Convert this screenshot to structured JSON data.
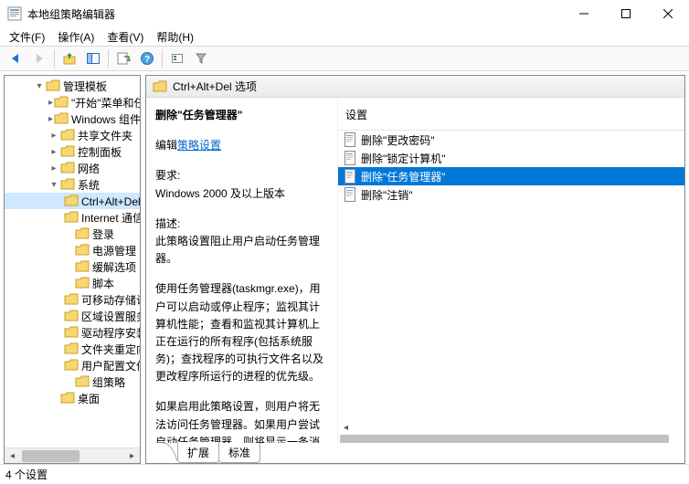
{
  "window": {
    "title": "本地组策略编辑器"
  },
  "menu": {
    "file": "文件(F)",
    "action": "操作(A)",
    "view": "查看(V)",
    "help": "帮助(H)"
  },
  "tree": [
    {
      "level": 2,
      "toggle": "▾",
      "label": "管理模板"
    },
    {
      "level": 3,
      "toggle": "▸",
      "label": "\"开始\"菜单和任务栏"
    },
    {
      "level": 3,
      "toggle": "▸",
      "label": "Windows 组件"
    },
    {
      "level": 3,
      "toggle": "▸",
      "label": "共享文件夹"
    },
    {
      "level": 3,
      "toggle": "▸",
      "label": "控制面板"
    },
    {
      "level": 3,
      "toggle": "▸",
      "label": "网络"
    },
    {
      "level": 3,
      "toggle": "▾",
      "label": "系统"
    },
    {
      "level": 4,
      "toggle": "",
      "label": "Ctrl+Alt+Del 选项",
      "selected": true
    },
    {
      "level": 4,
      "toggle": "",
      "label": "Internet 通信管理"
    },
    {
      "level": 4,
      "toggle": "",
      "label": "登录"
    },
    {
      "level": 4,
      "toggle": "",
      "label": "电源管理"
    },
    {
      "level": 4,
      "toggle": "",
      "label": "缓解选项"
    },
    {
      "level": 4,
      "toggle": "",
      "label": "脚本"
    },
    {
      "level": 4,
      "toggle": "",
      "label": "可移动存储访问"
    },
    {
      "level": 4,
      "toggle": "",
      "label": "区域设置服务"
    },
    {
      "level": 4,
      "toggle": "",
      "label": "驱动程序安装"
    },
    {
      "level": 4,
      "toggle": "",
      "label": "文件夹重定向"
    },
    {
      "level": 4,
      "toggle": "",
      "label": "用户配置文件"
    },
    {
      "level": 4,
      "toggle": "",
      "label": "组策略"
    },
    {
      "level": 3,
      "toggle": "",
      "label": "桌面"
    }
  ],
  "content": {
    "header": "Ctrl+Alt+Del 选项",
    "policy_name": "删除\"任务管理器\"",
    "edit_prefix": "编辑",
    "edit_link": "策略设置",
    "requirements_label": "要求:",
    "requirements_text": "Windows 2000 及以上版本",
    "description_label": "描述:",
    "description_p1": "此策略设置阻止用户启动任务管理器。",
    "description_p2": "使用任务管理器(taskmgr.exe)，用户可以启动或停止程序；监视其计算机性能；查看和监视其计算机上正在运行的所有程序(包括系统服务)；查找程序的可执行文件名以及更改程序所运行的进程的优先级。",
    "description_p3": "如果启用此策略设置，则用户将无法访问任务管理器。如果用户尝试启动任务管理器，则将显示一条消"
  },
  "settings": {
    "header": "设置",
    "items": [
      {
        "label": "删除\"更改密码\"",
        "selected": false
      },
      {
        "label": "删除\"锁定计算机\"",
        "selected": false
      },
      {
        "label": "删除\"任务管理器\"",
        "selected": true
      },
      {
        "label": "删除\"注销\"",
        "selected": false
      }
    ]
  },
  "tabs": {
    "extended": "扩展",
    "standard": "标准"
  },
  "status": "4 个设置"
}
